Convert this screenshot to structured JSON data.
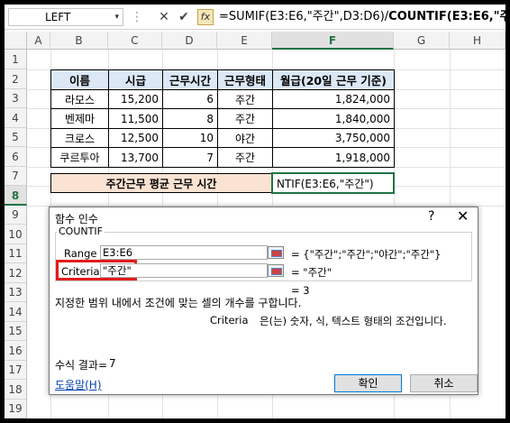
{
  "formula_bar": {
    "name_box": "LEFT",
    "name_box_dropdown": "▾",
    "dots": "⋮",
    "cancel": "✕",
    "enter": "✔",
    "fx": "fx",
    "formula_prefix": "=SUMIF(E3:E6,\"주간\",D3:D6)/",
    "formula_bold": "COUNTIF(E3:E6,\"주간\")"
  },
  "columns": [
    "A",
    "B",
    "C",
    "D",
    "E",
    "F",
    "G",
    "H"
  ],
  "rows": [
    "1",
    "2",
    "3",
    "4",
    "5",
    "6",
    "7",
    "8",
    "9",
    "10",
    "11",
    "12",
    "13",
    "14",
    "15",
    "16",
    "17",
    "18",
    "19"
  ],
  "table": {
    "headers": [
      "이름",
      "시급",
      "근무시간",
      "근무형태",
      "월급(20일 근무 기준)"
    ],
    "rows": [
      [
        "라모스",
        "15,200",
        "6",
        "주간",
        "1,824,000"
      ],
      [
        "벤제마",
        "11,500",
        "8",
        "주간",
        "1,840,000"
      ],
      [
        "크로스",
        "12,500",
        "10",
        "야간",
        "3,750,000"
      ],
      [
        "쿠르투아",
        "13,700",
        "7",
        "주간",
        "1,918,000"
      ]
    ]
  },
  "summary": {
    "label": "주간근무 평균 근무 시간",
    "editing_text": "NTIF(E3:E6,\"주간\")"
  },
  "dialog": {
    "title": "함수 인수",
    "help_glyph": "?",
    "close_glyph": "✕",
    "function_name": "COUNTIF",
    "range_label": "Range",
    "range_value": "E3:E6",
    "range_result": "= {\"주간\";\"주간\";\"야간\";\"주간\"}",
    "criteria_label": "Criteria",
    "criteria_value": "\"주간\"",
    "criteria_result": "= \"주간\"",
    "function_result": "= 3",
    "description": "지정한 범위 내에서 조건에 맞는 셀의 개수를 구합니다.",
    "arg_help_name": "Criteria",
    "arg_help_text": "은(는) 숫자, 식, 텍스트 형태의 조건입니다.",
    "formula_result_label": "수식 결과=",
    "formula_result_value": "7",
    "help_link": "도움말(H)",
    "ok_label": "확인",
    "cancel_label": "취소"
  },
  "colors": {
    "header_fill": "#dce8f5",
    "summary_fill": "#fbe3d3",
    "highlight_red": "#e31b1b",
    "excel_green": "#217346"
  }
}
